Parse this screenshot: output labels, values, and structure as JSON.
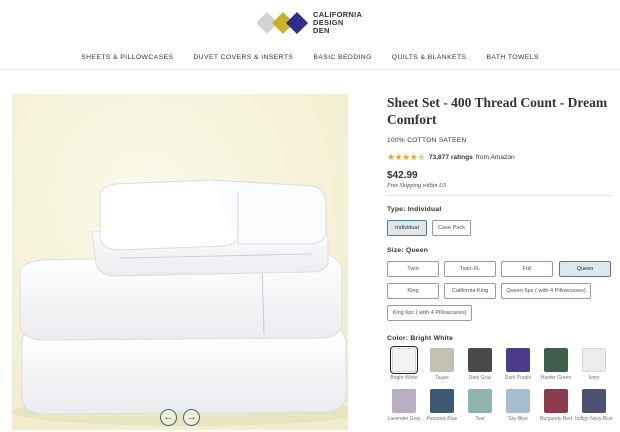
{
  "brand": {
    "logo_text_line1": "CALIFORNIA",
    "logo_text_line2": "DESIGN",
    "logo_text_line3": "DEN",
    "colors": {
      "gray": "#d3d3d3",
      "yellow": "#c9b12a",
      "navy": "#2d2e8c"
    }
  },
  "nav": {
    "items": [
      "SHEETS & PILLOWCASES",
      "DUVET COVERS & INSERTS",
      "BASIC BEDDING",
      "QUILTS & BLANKETS",
      "BATH TOWELS"
    ]
  },
  "product": {
    "title": "Sheet Set - 400 Thread Count - Dream Comfort",
    "subtitle": "100% COTTON SATEEN",
    "rating_stars": 4.5,
    "rating_count": "73,877 ratings",
    "rating_source": "from Amazon",
    "price": "$42.99",
    "shipping": "Free Shipping within US"
  },
  "gallery": {
    "prev_icon": "arrow-left-icon",
    "next_icon": "arrow-right-icon",
    "background": "#f4f1d8"
  },
  "type": {
    "label": "Type:",
    "selected": "Individual",
    "options": [
      "Individual",
      "Case Pack"
    ]
  },
  "size": {
    "label": "Size:",
    "selected": "Queen",
    "options": [
      "Twin",
      "Twin-XL",
      "Full",
      "Queen",
      "King",
      "California King",
      "Queen 6pc ( with 4 Pillowcases)",
      "King 6pc ( with 4 Pillowcases)"
    ]
  },
  "color": {
    "label": "Color:",
    "selected": "Bright White",
    "options": [
      {
        "name": "Bright White",
        "hex": "#f4f4f4"
      },
      {
        "name": "Taupe",
        "hex": "#c3bfb3"
      },
      {
        "name": "Dark Gray",
        "hex": "#4a4a4a"
      },
      {
        "name": "Dark Purple",
        "hex": "#4d3a8a"
      },
      {
        "name": "Hunter Green",
        "hex": "#3f5e4c"
      },
      {
        "name": "Ivory",
        "hex": "#ececea"
      },
      {
        "name": "Lavender Gray",
        "hex": "#b9adc2"
      },
      {
        "name": "Peacock Blue",
        "hex": "#3c5a73"
      },
      {
        "name": "Teal",
        "hex": "#8fb3ad"
      },
      {
        "name": "Sky Blue",
        "hex": "#a9bdd1"
      },
      {
        "name": "Burgundy Red",
        "hex": "#8a3c4c"
      },
      {
        "name": "Indigo Navy Blue",
        "hex": "#4e5272"
      }
    ]
  }
}
